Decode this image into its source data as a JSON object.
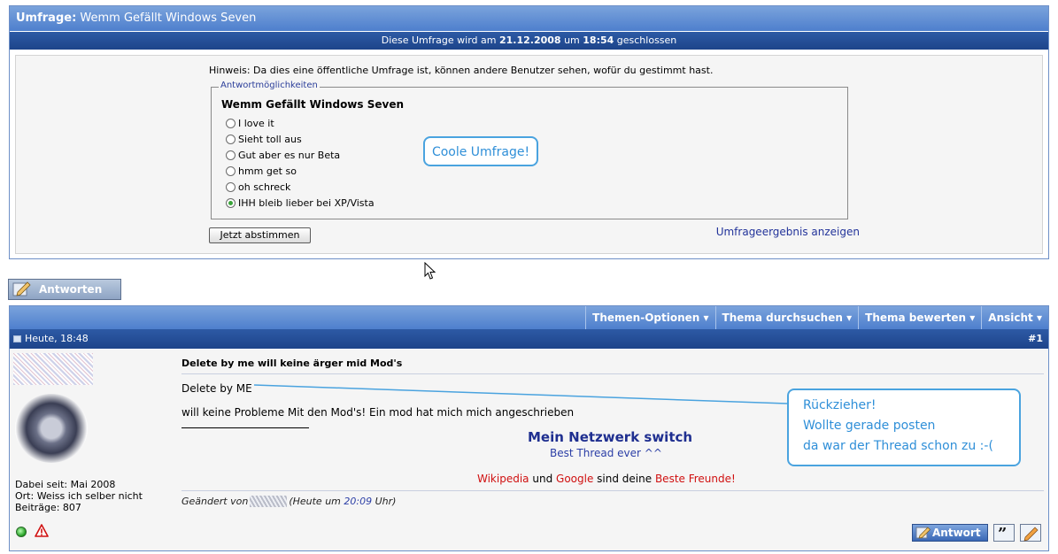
{
  "poll": {
    "title_label": "Umfrage:",
    "title_text": "Wemm Gefällt Windows Seven",
    "close_prefix": "Diese Umfrage wird am",
    "close_date": "21.12.2008",
    "close_mid": "um",
    "close_time": "18:54",
    "close_suffix": "geschlossen",
    "hint": "Hinweis: Da dies eine öffentliche Umfrage ist, können andere Benutzer sehen, wofür du gestimmt hast.",
    "legend": "Antwortmöglichkeiten",
    "question": "Wemm Gefällt Windows Seven",
    "options": [
      {
        "label": "I love it",
        "selected": false
      },
      {
        "label": "Sieht toll aus",
        "selected": false
      },
      {
        "label": "Gut aber es nur Beta",
        "selected": false
      },
      {
        "label": "hmm get so",
        "selected": false
      },
      {
        "label": "oh schreck",
        "selected": false
      },
      {
        "label": "IHH bleib lieber bei XP/Vista",
        "selected": true
      }
    ],
    "callout": "Coole Umfrage!",
    "vote_button": "Jetzt abstimmen",
    "results_link": "Umfrageergebnis anzeigen"
  },
  "reply_button": "Antworten",
  "toolbar": {
    "options": "Themen-Optionen",
    "search": "Thema durchsuchen",
    "rate": "Thema bewerten",
    "view": "Ansicht"
  },
  "post": {
    "date": "Heute, 18:48",
    "number": "#1",
    "title": "Delete by me will keine ärger mid Mod's",
    "line1": "Delete by ME",
    "line2": "will keine Probleme Mit den Mod's! Ein mod hat mich mich angeschrieben",
    "sig_title": "Mein Netzwerk switch",
    "sig_sub": "Best Thread ever ^^",
    "sig_link1": "Wikipedia",
    "sig_and": "und",
    "sig_link2": "Google",
    "sig_mid": "sind deine",
    "sig_link3": "Beste Freunde!",
    "edited_prefix": "Geändert von",
    "edited_mid": "(Heute um",
    "edited_time": "20:09",
    "edited_suffix": "Uhr)",
    "callout_lines": [
      "Rückzieher!",
      "Wollte gerade posten",
      "da war der Thread schon zu :-("
    ],
    "reply_button": "Antwort"
  },
  "user": {
    "joined": "Dabei seit: Mai 2008",
    "location": "Ort: Weiss ich selber nicht",
    "posts": "Beiträge: 807"
  },
  "colors": {
    "header_blue": "#4e7fcd",
    "dark_blue": "#1d448a",
    "callout_blue": "#4aa3df",
    "link_red": "#d01010"
  }
}
